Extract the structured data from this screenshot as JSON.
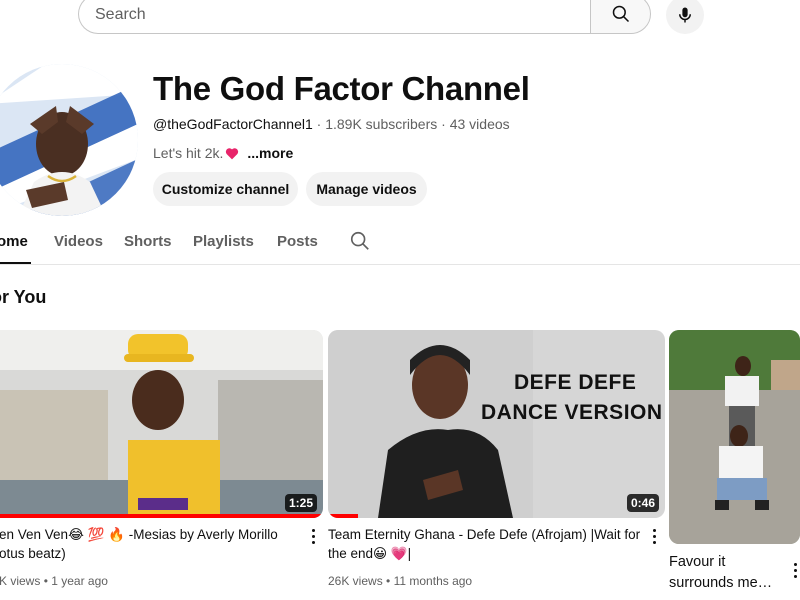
{
  "search": {
    "placeholder": "Search",
    "value": ""
  },
  "channel": {
    "name": "The God Factor Channel",
    "handle": "@theGodFactorChannel1",
    "subscribers": "1.89K subscribers",
    "videos": "43 videos",
    "separator": "·",
    "description": "Let's hit 2k.",
    "more_label": "...more",
    "customize_label": "Customize channel",
    "manage_label": "Manage videos"
  },
  "tabs": [
    {
      "label": "ome",
      "active": true
    },
    {
      "label": "Videos"
    },
    {
      "label": "Shorts"
    },
    {
      "label": "Playlists"
    },
    {
      "label": "Posts"
    }
  ],
  "section": {
    "title": "or You"
  },
  "videos": [
    {
      "title_line1": "en Ven Ven😂 💯 🔥 -Mesias by Averly Morillo",
      "title_line2": "otus beatz)",
      "duration": "1:25",
      "views": "K views",
      "age": "1 year ago",
      "progress": 1.0
    },
    {
      "title_line1": "Team Eternity Ghana - Defe Defe (Afrojam) |Wait for",
      "title_line2": "the end😀 💗|",
      "duration": "0:46",
      "views": "26K views",
      "age": "11 months ago",
      "thumb_text_line1": "DEFE DEFE",
      "thumb_text_line2": "DANCE VERSION",
      "progress": 0.09
    },
    {
      "title_line1": "Favour it",
      "title_line2": "surrounds me…"
    }
  ],
  "meta_separator": "•",
  "colors": {
    "accent": "#ff0000",
    "text_secondary": "#606060",
    "chip_bg": "#f2f2f2"
  },
  "icons": [
    "search-icon",
    "mic-icon",
    "heart-icon",
    "more-vert-icon"
  ]
}
